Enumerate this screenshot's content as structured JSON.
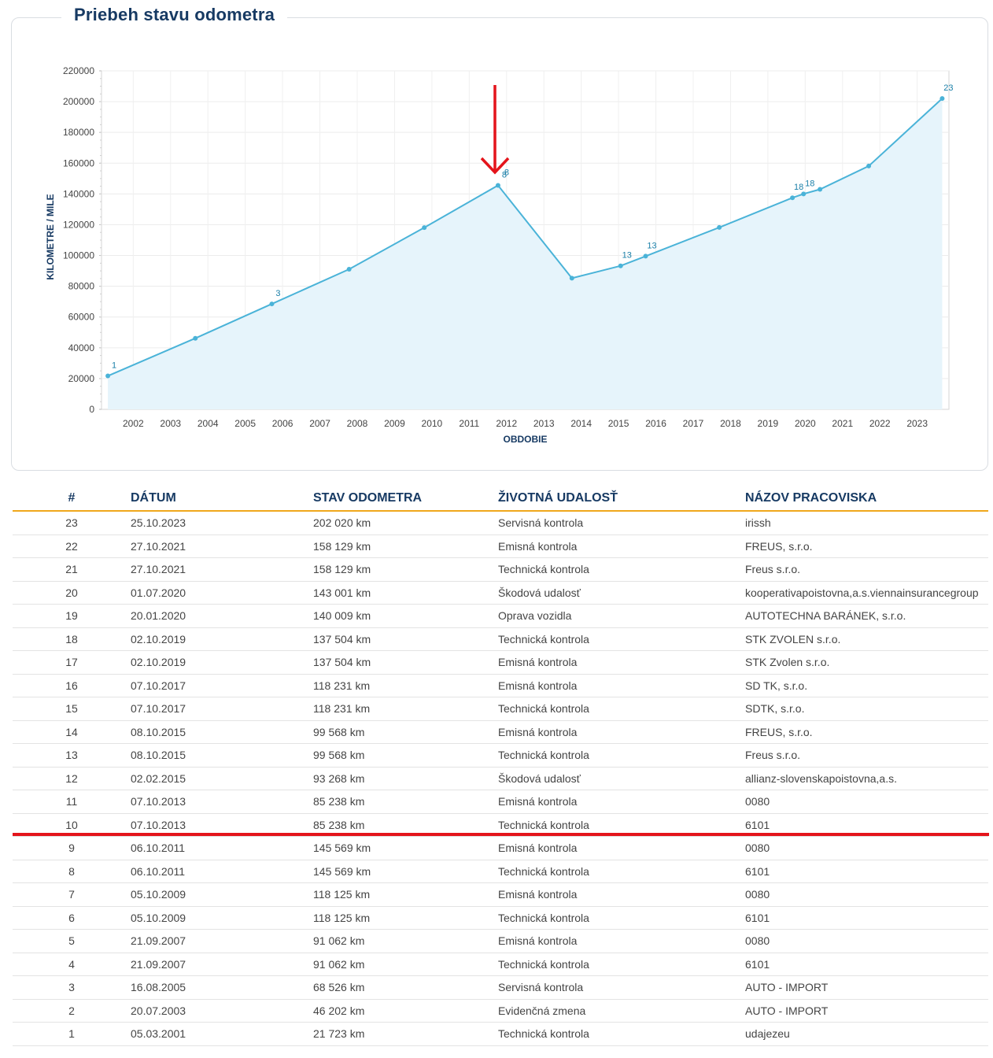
{
  "panel": {
    "title": "Priebeh stavu odometra"
  },
  "chart_data": {
    "type": "area",
    "title": "Priebeh stavu odometra",
    "xlabel": "OBDOBIE",
    "ylabel": "KILOMETRE / MILE",
    "ylim": [
      0,
      220000
    ],
    "yticks": [
      0,
      20000,
      40000,
      60000,
      80000,
      100000,
      120000,
      140000,
      160000,
      180000,
      200000,
      220000
    ],
    "xticks": [
      "2002",
      "2003",
      "2004",
      "2005",
      "2006",
      "2007",
      "2008",
      "2009",
      "2010",
      "2011",
      "2012",
      "2013",
      "2014",
      "2015",
      "2016",
      "2017",
      "2018",
      "2019",
      "2020",
      "2021",
      "2022",
      "2023"
    ],
    "grid": true,
    "legend": "none",
    "series": [
      {
        "x": [
          "2001-03-05",
          "2003-07-20",
          "2005-08-16",
          "2007-09-21",
          "2009-10-05",
          "2011-10-06",
          "2013-10-07",
          "2015-02-02",
          "2015-10-08",
          "2017-10-07",
          "2019-10-02",
          "2020-01-20",
          "2020-07-01",
          "2021-10-27",
          "2023-10-25"
        ],
        "y": [
          21723,
          46202,
          68526,
          91062,
          118125,
          145569,
          85238,
          93268,
          99568,
          118231,
          137504,
          140009,
          143001,
          158129,
          202020
        ],
        "point_labels": [
          "1",
          "",
          "3",
          "",
          "",
          "8",
          "",
          "13",
          "13",
          "",
          "18",
          "18",
          "",
          "",
          "23"
        ]
      }
    ],
    "extra_labels": [
      {
        "text": "8",
        "value_index": 5,
        "side": "above"
      }
    ],
    "colors": {
      "line": "#4ab3d8",
      "fill": "#e6f4fb",
      "axis_text": "#444444",
      "label": "#1a7fa8",
      "annotation": "#e4141b"
    }
  },
  "table": {
    "headers": [
      "#",
      "DÁTUM",
      "STAV ODOMETRA",
      "ŽIVOTNÁ UDALOSŤ",
      "NÁZOV PRACOVISKA"
    ],
    "rows": [
      [
        "23",
        "25.10.2023",
        "202 020 km",
        "Servisná kontrola",
        "irissh"
      ],
      [
        "22",
        "27.10.2021",
        "158 129 km",
        "Emisná kontrola",
        "FREUS, s.r.o."
      ],
      [
        "21",
        "27.10.2021",
        "158 129 km",
        "Technická kontrola",
        "Freus s.r.o."
      ],
      [
        "20",
        "01.07.2020",
        "143 001 km",
        "Škodová udalosť",
        "kooperativapoistovna,a.s.viennainsurancegroup"
      ],
      [
        "19",
        "20.01.2020",
        "140 009 km",
        "Oprava vozidla",
        "AUTOTECHNA BARÁNEK, s.r.o."
      ],
      [
        "18",
        "02.10.2019",
        "137 504 km",
        "Technická kontrola",
        "STK ZVOLEN s.r.o."
      ],
      [
        "17",
        "02.10.2019",
        "137 504 km",
        "Emisná kontrola",
        "STK  Zvolen s.r.o."
      ],
      [
        "16",
        "07.10.2017",
        "118 231 km",
        "Emisná kontrola",
        "SD TK, s.r.o."
      ],
      [
        "15",
        "07.10.2017",
        "118 231 km",
        "Technická kontrola",
        "SDTK, s.r.o."
      ],
      [
        "14",
        "08.10.2015",
        "99 568 km",
        "Emisná kontrola",
        "FREUS, s.r.o."
      ],
      [
        "13",
        "08.10.2015",
        "99 568 km",
        "Technická kontrola",
        "Freus s.r.o."
      ],
      [
        "12",
        "02.02.2015",
        "93 268 km",
        "Škodová udalosť",
        "allianz-slovenskapoistovna,a.s."
      ],
      [
        "11",
        "07.10.2013",
        "85 238 km",
        "Emisná kontrola",
        "0080"
      ],
      [
        "10",
        "07.10.2013",
        "85 238 km",
        "Technická kontrola",
        "6101"
      ],
      [
        "9",
        "06.10.2011",
        "145 569 km",
        "Emisná kontrola",
        "0080"
      ],
      [
        "8",
        "06.10.2011",
        "145 569 km",
        "Technická kontrola",
        "6101"
      ],
      [
        "7",
        "05.10.2009",
        "118 125 km",
        "Emisná kontrola",
        "0080"
      ],
      [
        "6",
        "05.10.2009",
        "118 125 km",
        "Technická kontrola",
        "6101"
      ],
      [
        "5",
        "21.09.2007",
        "91 062 km",
        "Emisná kontrola",
        "0080"
      ],
      [
        "4",
        "21.09.2007",
        "91 062 km",
        "Technická kontrola",
        "6101"
      ],
      [
        "3",
        "16.08.2005",
        "68 526 km",
        "Servisná kontrola",
        "AUTO - IMPORT"
      ],
      [
        "2",
        "20.07.2003",
        "46 202 km",
        "Evidenčná zmena",
        "AUTO - IMPORT"
      ],
      [
        "1",
        "05.03.2001",
        "21 723 km",
        "Technická kontrola",
        "udajezeu"
      ]
    ]
  }
}
